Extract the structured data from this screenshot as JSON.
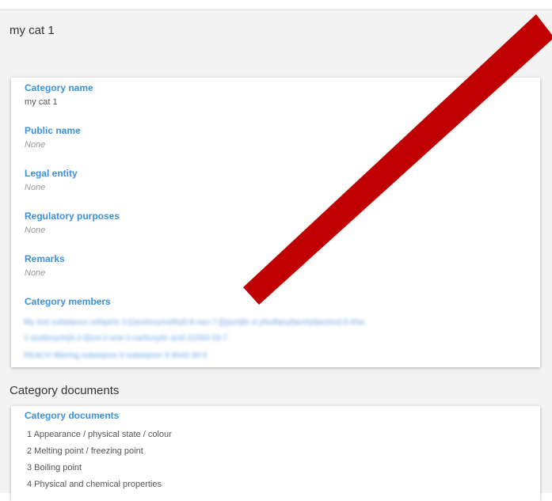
{
  "header": {
    "title": "my cat 1"
  },
  "details": {
    "category_name": {
      "label": "Category name",
      "value": "my cat 1"
    },
    "public_name": {
      "label": "Public name",
      "value": "None"
    },
    "legal_entity": {
      "label": "Legal entity",
      "value": "None"
    },
    "regulatory_purposes": {
      "label": "Regulatory purposes",
      "value": "None"
    },
    "remarks": {
      "label": "Remarks",
      "value": "None"
    },
    "category_members": {
      "label": "Category members",
      "items": [
        "My test substance cefapirin 3-[(acetoxymethyl)-8-oxo-7-[[(pyridin-4-ylsulfanyl)acetyl]amino]-5-thia-",
        "1-azabicyclo[4.2.0]oct-2-ene-2-carboxylic acid 21593-23-7",
        "REACH filtering substance 9 substance 9 9043-30-5"
      ]
    }
  },
  "documents": {
    "section_title": "Category documents",
    "label": "Category documents",
    "items": [
      "1 Appearance / physical state / colour",
      "2 Melting point / freezing point",
      "3 Boiling point",
      "4 Physical and chemical properties"
    ]
  },
  "colors": {
    "accent": "#3d8fe0",
    "redaction": "#c00000"
  }
}
